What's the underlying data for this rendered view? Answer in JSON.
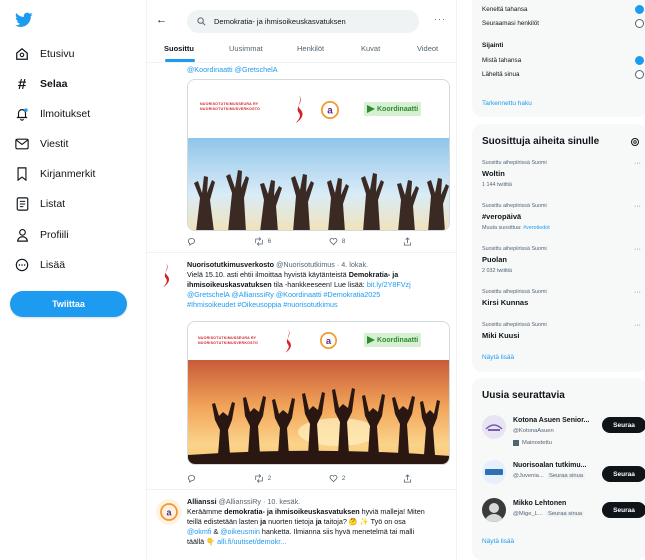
{
  "nav": {
    "items": [
      {
        "label": "Etusivu",
        "icon": "home-icon"
      },
      {
        "label": "Selaa",
        "icon": "hashtag-icon"
      },
      {
        "label": "Ilmoitukset",
        "icon": "bell-icon"
      },
      {
        "label": "Viestit",
        "icon": "mail-icon"
      },
      {
        "label": "Kirjanmerkit",
        "icon": "bookmark-icon"
      },
      {
        "label": "Listat",
        "icon": "list-icon"
      },
      {
        "label": "Profiili",
        "icon": "profile-icon"
      },
      {
        "label": "Lisää",
        "icon": "more-icon"
      }
    ],
    "tweet_button": "Twiittaa"
  },
  "search": {
    "query": "Demokratia- ja ihmisoikeuskasvatuksen"
  },
  "tabs": [
    "Suosittu",
    "Uusimmat",
    "Henkilöt",
    "Kuvat",
    "Videot"
  ],
  "tweets": [
    {
      "mentions": "@Koordinaatti @GretschelA",
      "counts": {
        "retweets": "6",
        "likes": "8"
      }
    },
    {
      "name": "Nuorisotutkimusverkosto",
      "handle": "@Nuorisotutkimus · 4. lokak.",
      "line1": "Vielä 15.10. asti ehtii ilmoittaa hyvistä käytänteistä",
      "bold1": "Demokratia- ja",
      "bold2": "ihmisoikeuskasvatuksen",
      "line2": "tila -hankkeeseen! Lue lisää:",
      "url": "bit.ly/2Y8FVzj",
      "line3": "@GretschelA @AllianssiRy @Koordinaatti #Demokratia2025",
      "line4": "#Ihmisoikeudet #Oikeusoppia #nuorisotutkimus",
      "counts": {
        "retweets": "2",
        "likes": "2"
      }
    },
    {
      "name": "Allianssi",
      "handle": "@AllianssiRy · 10. kesäk.",
      "line1a": "Keräämme",
      "bold1": "demokratia- ja ihmisoikeuskasvatuksen",
      "line1b": "hyviä malleja! Miten",
      "line2a": "teillä edistetään lasten",
      "bold2": "ja",
      "line2b": "nuorten tietoja",
      "bold3": "ja",
      "line2c": "taitoja? 🤔 ✨ Työ on osa",
      "line3a": "@okmfi",
      "line3b": "&",
      "line3c": "@oikeusmin",
      "line3d": "hanketta. Ilmianna siis hyvä menetelmä tai malli",
      "line4a": "täällä 👇",
      "line4b": "alli.fi/uutiset/demokr..."
    }
  ],
  "banner": {
    "nts_line1": "NUORISOTUTKIMUSSEURA RY",
    "nts_line2": "NUORISOTUTKIMUSVERKOSTO",
    "koordinaatti": "Koordinaatti"
  },
  "location": {
    "anyone": "Keneltä tahansa",
    "following": "Seuraamasi henkilöt",
    "heading": "Sijainti",
    "anywhere": "Mistä tahansa",
    "near": "Läheltä sinua",
    "advanced": "Tarkennettu haku"
  },
  "trends": {
    "title": "Suosittuja aiheita sinulle",
    "items": [
      {
        "ctx": "Suosittu aihepiirissä Suomi",
        "name": "Woltin",
        "count": "1 144 twiittiä"
      },
      {
        "ctx": "Suosittu aihepiirissä Suomi",
        "name": "#veropäivä",
        "count_prefix": "Muuta suosittua:",
        "count_link": "#verotiedot"
      },
      {
        "ctx": "Suosittu aihepiirissä Suomi",
        "name": "Puolan",
        "count": "2 032 twiittiä"
      },
      {
        "ctx": "Suosittu aihepiirissä Suomi",
        "name": "Kirsi Kunnas"
      },
      {
        "ctx": "Suosittu aihepiirissä Suomi",
        "name": "Miki Kuusi"
      }
    ],
    "show_more": "Näytä lisää"
  },
  "follow": {
    "title": "Uusia seurattavia",
    "items": [
      {
        "name": "Kotona Asuen Senior...",
        "handle": "@KotonaAsuen",
        "promoted": "Mainostettu"
      },
      {
        "name": "Nuorisoalan tutkimu...",
        "handle": "@Juvenia...",
        "follows": "Seuraa sinua"
      },
      {
        "name": "Mikko Lehtonen",
        "handle": "@Mige_L...",
        "follows": "Seuraa sinua"
      }
    ],
    "button": "Seuraa",
    "show_more": "Näytä lisää"
  },
  "colors": {
    "accent": "#1d9bf0",
    "text": "#0f1419",
    "muted": "#536471",
    "nts_red": "#d1232a",
    "koord_green": "#2e8b2e"
  }
}
